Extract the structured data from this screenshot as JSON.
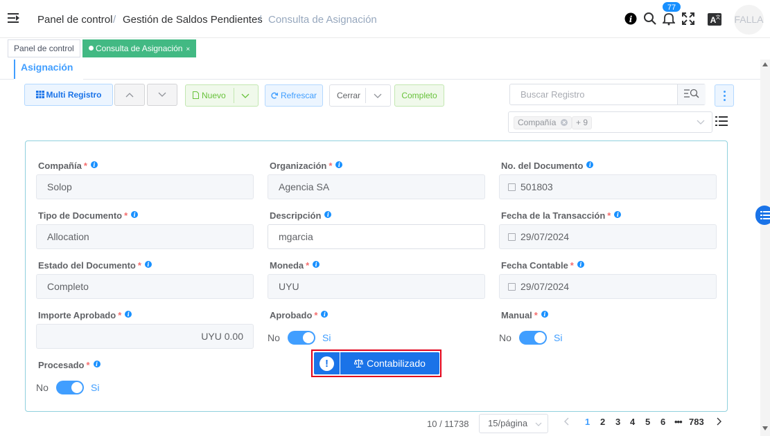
{
  "header": {
    "breadcrumbs": [
      "Panel de control",
      "Gestión de Saldos Pendientes",
      "Consulta de Asignación"
    ],
    "notification_count": "77",
    "avatar_text": "FALLA"
  },
  "tags": {
    "items": [
      {
        "label": "Panel de control",
        "active": false
      },
      {
        "label": "Consulta de Asignación",
        "active": true
      }
    ],
    "close_symbol": "×"
  },
  "tab": {
    "label": "Asignación"
  },
  "toolbar": {
    "multi_registro": "Multi Registro",
    "nuevo": "Nuevo",
    "refrescar": "Refrescar",
    "cerrar": "Cerrar",
    "completo": "Completo"
  },
  "search": {
    "placeholder": "Buscar Registro"
  },
  "filter": {
    "chip": "Compañía",
    "more": "+ 9"
  },
  "form": {
    "fields": [
      {
        "label": "Compañía",
        "value": "Solop"
      },
      {
        "label": "Organización",
        "value": "Agencia SA"
      },
      {
        "label": "No. del Documento",
        "value": "501803"
      },
      {
        "label": "Tipo de Documento",
        "value": "Allocation"
      },
      {
        "label": "Descripción",
        "value": "mgarcia"
      },
      {
        "label": "Fecha de la Transacción",
        "value": "29/07/2024"
      },
      {
        "label": "Estado del Documento",
        "value": "Completo"
      },
      {
        "label": "Moneda",
        "value": "UYU"
      },
      {
        "label": "Fecha Contable",
        "value": "29/07/2024"
      },
      {
        "label": "Importe Aprobado",
        "value": "UYU 0.00"
      },
      {
        "label": "Aprobado",
        "value": ""
      },
      {
        "label": "Manual",
        "value": ""
      },
      {
        "label": "Procesado",
        "value": ""
      }
    ],
    "switch_no": "No",
    "switch_si": "Si",
    "required_mark": "*",
    "info_mark": "i"
  },
  "process": {
    "warning_mark": "!",
    "label": "Contabilizado"
  },
  "pagination": {
    "record": "10 / 11738",
    "per_page": "15/página",
    "pages": [
      "1",
      "2",
      "3",
      "4",
      "5",
      "6"
    ],
    "ellipsis": "•••",
    "last": "783",
    "current": "1"
  },
  "colors": {
    "primary": "#409eff",
    "accent": "#1a73e8",
    "tag_active": "#42b983",
    "highlight": "#e0001a"
  }
}
